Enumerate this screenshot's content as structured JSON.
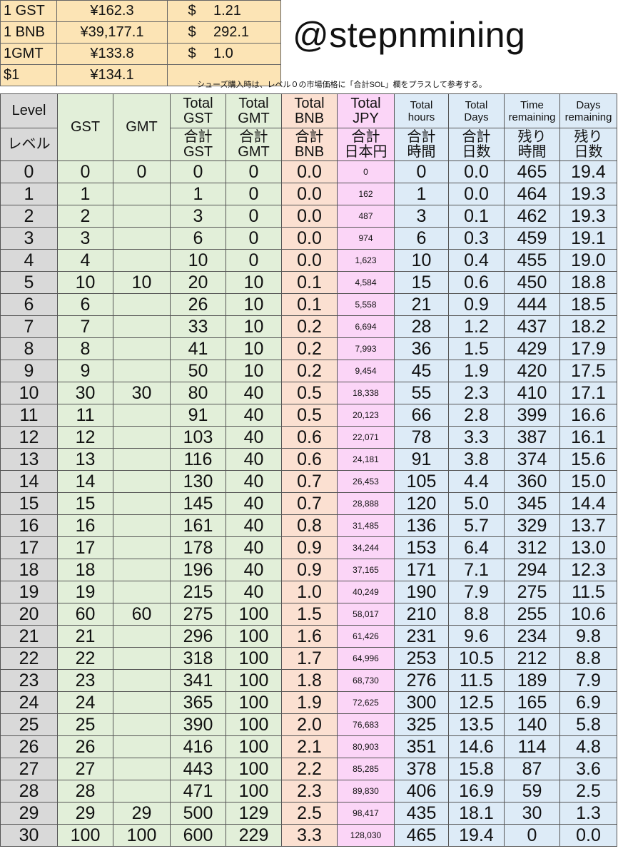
{
  "rates": [
    {
      "label": "1 GST",
      "jpy": "¥162.3",
      "usd_sym": "$",
      "usd": "1.21"
    },
    {
      "label": "1 BNB",
      "jpy": "¥39,177.1",
      "usd_sym": "$",
      "usd": "292.1"
    },
    {
      "label": "1GMT",
      "jpy": "¥133.8",
      "usd_sym": "$",
      "usd": "1.0"
    },
    {
      "label": "$1",
      "jpy": "¥134.1",
      "usd_sym": "",
      "usd": ""
    }
  ],
  "brand": "@stepnmining",
  "note": "シューズ購入時は、レベル０の市場価格に「合計SOL」欄をプラスして参考する。",
  "headers": {
    "level_en": "Level",
    "level_jp": "レベル",
    "gst": "GST",
    "gmt": "GMT",
    "total_gst": [
      "Total",
      "GST",
      "合計",
      "GST"
    ],
    "total_gmt": [
      "Total",
      "GMT",
      "合計",
      "GMT"
    ],
    "total_bnb": [
      "Total",
      "BNB",
      "合計",
      "BNB"
    ],
    "total_jpy": [
      "Total",
      "JPY",
      "合計",
      "日本円"
    ],
    "total_hours": [
      "Total",
      "hours",
      "合計",
      "時間"
    ],
    "total_days": [
      "Total",
      "Days",
      "合計",
      "日数"
    ],
    "time_remaining": [
      "Time",
      "remaining",
      "残り",
      "時間"
    ],
    "days_remaining": [
      "Days",
      "remaining",
      "残り",
      "日数"
    ]
  },
  "rows": [
    [
      "0",
      "0",
      "0",
      "0",
      "0",
      "0.0",
      "0",
      "0",
      "0.0",
      "465",
      "19.4"
    ],
    [
      "1",
      "1",
      "",
      "1",
      "0",
      "0.0",
      "162",
      "1",
      "0.0",
      "464",
      "19.3"
    ],
    [
      "2",
      "2",
      "",
      "3",
      "0",
      "0.0",
      "487",
      "3",
      "0.1",
      "462",
      "19.3"
    ],
    [
      "3",
      "3",
      "",
      "6",
      "0",
      "0.0",
      "974",
      "6",
      "0.3",
      "459",
      "19.1"
    ],
    [
      "4",
      "4",
      "",
      "10",
      "0",
      "0.0",
      "1,623",
      "10",
      "0.4",
      "455",
      "19.0"
    ],
    [
      "5",
      "10",
      "10",
      "20",
      "10",
      "0.1",
      "4,584",
      "15",
      "0.6",
      "450",
      "18.8"
    ],
    [
      "6",
      "6",
      "",
      "26",
      "10",
      "0.1",
      "5,558",
      "21",
      "0.9",
      "444",
      "18.5"
    ],
    [
      "7",
      "7",
      "",
      "33",
      "10",
      "0.2",
      "6,694",
      "28",
      "1.2",
      "437",
      "18.2"
    ],
    [
      "8",
      "8",
      "",
      "41",
      "10",
      "0.2",
      "7,993",
      "36",
      "1.5",
      "429",
      "17.9"
    ],
    [
      "9",
      "9",
      "",
      "50",
      "10",
      "0.2",
      "9,454",
      "45",
      "1.9",
      "420",
      "17.5"
    ],
    [
      "10",
      "30",
      "30",
      "80",
      "40",
      "0.5",
      "18,338",
      "55",
      "2.3",
      "410",
      "17.1"
    ],
    [
      "11",
      "11",
      "",
      "91",
      "40",
      "0.5",
      "20,123",
      "66",
      "2.8",
      "399",
      "16.6"
    ],
    [
      "12",
      "12",
      "",
      "103",
      "40",
      "0.6",
      "22,071",
      "78",
      "3.3",
      "387",
      "16.1"
    ],
    [
      "13",
      "13",
      "",
      "116",
      "40",
      "0.6",
      "24,181",
      "91",
      "3.8",
      "374",
      "15.6"
    ],
    [
      "14",
      "14",
      "",
      "130",
      "40",
      "0.7",
      "26,453",
      "105",
      "4.4",
      "360",
      "15.0"
    ],
    [
      "15",
      "15",
      "",
      "145",
      "40",
      "0.7",
      "28,888",
      "120",
      "5.0",
      "345",
      "14.4"
    ],
    [
      "16",
      "16",
      "",
      "161",
      "40",
      "0.8",
      "31,485",
      "136",
      "5.7",
      "329",
      "13.7"
    ],
    [
      "17",
      "17",
      "",
      "178",
      "40",
      "0.9",
      "34,244",
      "153",
      "6.4",
      "312",
      "13.0"
    ],
    [
      "18",
      "18",
      "",
      "196",
      "40",
      "0.9",
      "37,165",
      "171",
      "7.1",
      "294",
      "12.3"
    ],
    [
      "19",
      "19",
      "",
      "215",
      "40",
      "1.0",
      "40,249",
      "190",
      "7.9",
      "275",
      "11.5"
    ],
    [
      "20",
      "60",
      "60",
      "275",
      "100",
      "1.5",
      "58,017",
      "210",
      "8.8",
      "255",
      "10.6"
    ],
    [
      "21",
      "21",
      "",
      "296",
      "100",
      "1.6",
      "61,426",
      "231",
      "9.6",
      "234",
      "9.8"
    ],
    [
      "22",
      "22",
      "",
      "318",
      "100",
      "1.7",
      "64,996",
      "253",
      "10.5",
      "212",
      "8.8"
    ],
    [
      "23",
      "23",
      "",
      "341",
      "100",
      "1.8",
      "68,730",
      "276",
      "11.5",
      "189",
      "7.9"
    ],
    [
      "24",
      "24",
      "",
      "365",
      "100",
      "1.9",
      "72,625",
      "300",
      "12.5",
      "165",
      "6.9"
    ],
    [
      "25",
      "25",
      "",
      "390",
      "100",
      "2.0",
      "76,683",
      "325",
      "13.5",
      "140",
      "5.8"
    ],
    [
      "26",
      "26",
      "",
      "416",
      "100",
      "2.1",
      "80,903",
      "351",
      "14.6",
      "114",
      "4.8"
    ],
    [
      "27",
      "27",
      "",
      "443",
      "100",
      "2.2",
      "85,285",
      "378",
      "15.8",
      "87",
      "3.6"
    ],
    [
      "28",
      "28",
      "",
      "471",
      "100",
      "2.3",
      "89,830",
      "406",
      "16.9",
      "59",
      "2.5"
    ],
    [
      "29",
      "29",
      "29",
      "500",
      "129",
      "2.5",
      "98,417",
      "435",
      "18.1",
      "30",
      "1.3"
    ],
    [
      "30",
      "100",
      "100",
      "600",
      "229",
      "3.3",
      "128,030",
      "465",
      "19.4",
      "0",
      "0.0"
    ]
  ],
  "colors": {
    "rates_bg": "#fce4b5",
    "level_bg": "#d9d9d9",
    "green_bg": "#e2efd9",
    "bnb_bg": "#fbe0d1",
    "jpy_bg": "#fbd5f7",
    "blue_bg": "#ddebf7"
  }
}
